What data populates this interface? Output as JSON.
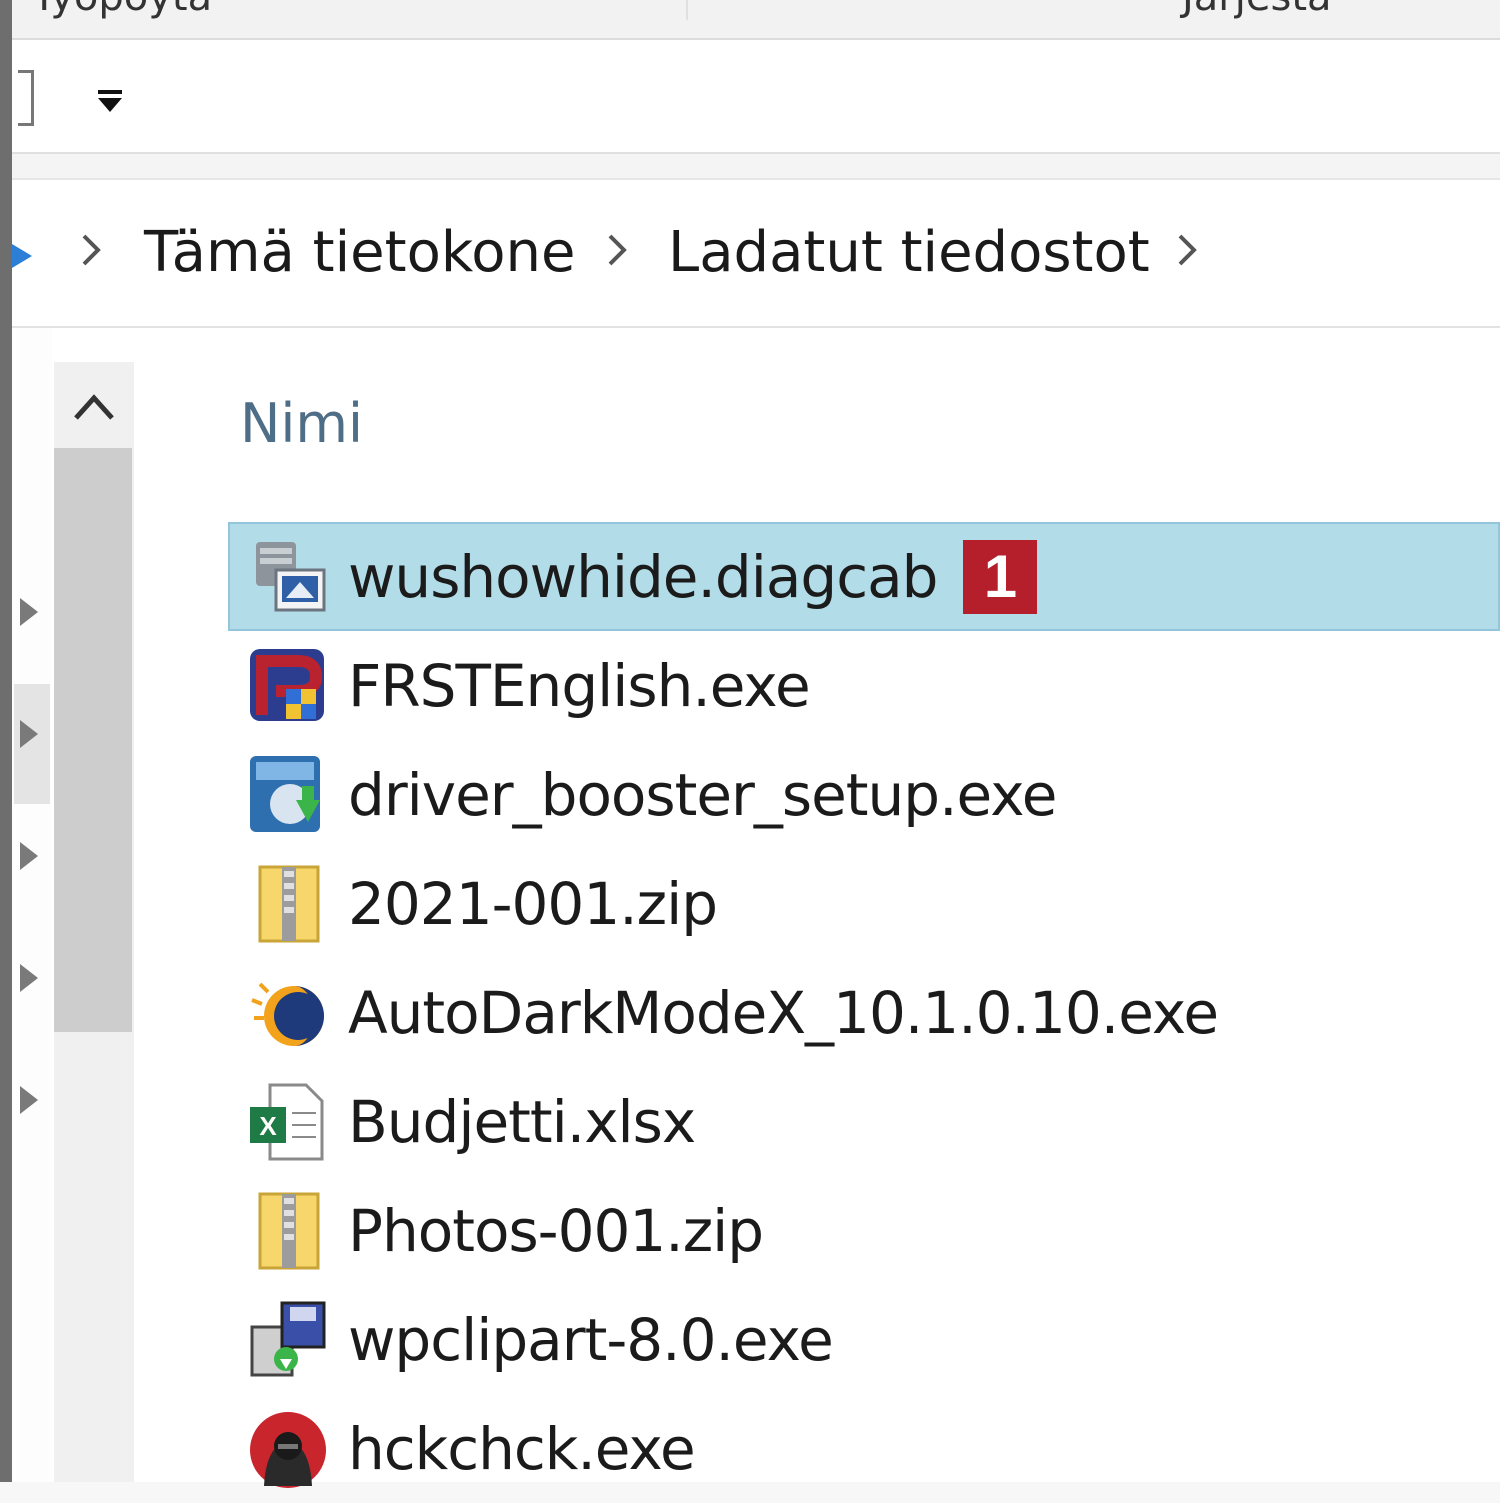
{
  "ribbon": {
    "left_label_partial": "Työpöytä",
    "right_label_partial": "Järjestä"
  },
  "address_bar": {
    "crumbs": [
      "Tämä tietokone",
      "Ladatut tiedostot"
    ]
  },
  "columns": {
    "name_header": "Nimi"
  },
  "files": [
    {
      "name": "wushowhide.diagcab",
      "icon": "diagcab-icon",
      "selected": true,
      "badge": "1"
    },
    {
      "name": "FRSTEnglish.exe",
      "icon": "frst-icon"
    },
    {
      "name": "driver_booster_setup.exe",
      "icon": "driver-booster-icon"
    },
    {
      "name": "2021-001.zip",
      "icon": "zip-folder-icon"
    },
    {
      "name": "AutoDarkModeX_10.1.0.10.exe",
      "icon": "autodarkmode-icon"
    },
    {
      "name": "Budjetti.xlsx",
      "icon": "excel-icon"
    },
    {
      "name": "Photos-001.zip",
      "icon": "zip-folder-icon"
    },
    {
      "name": "wpclipart-8.0.exe",
      "icon": "installer-icon"
    },
    {
      "name": "hckchck.exe",
      "icon": "hacker-icon"
    }
  ],
  "colors": {
    "selection": "#b3dce9",
    "badge": "#b41f2b",
    "header_text": "#4e6d86"
  }
}
